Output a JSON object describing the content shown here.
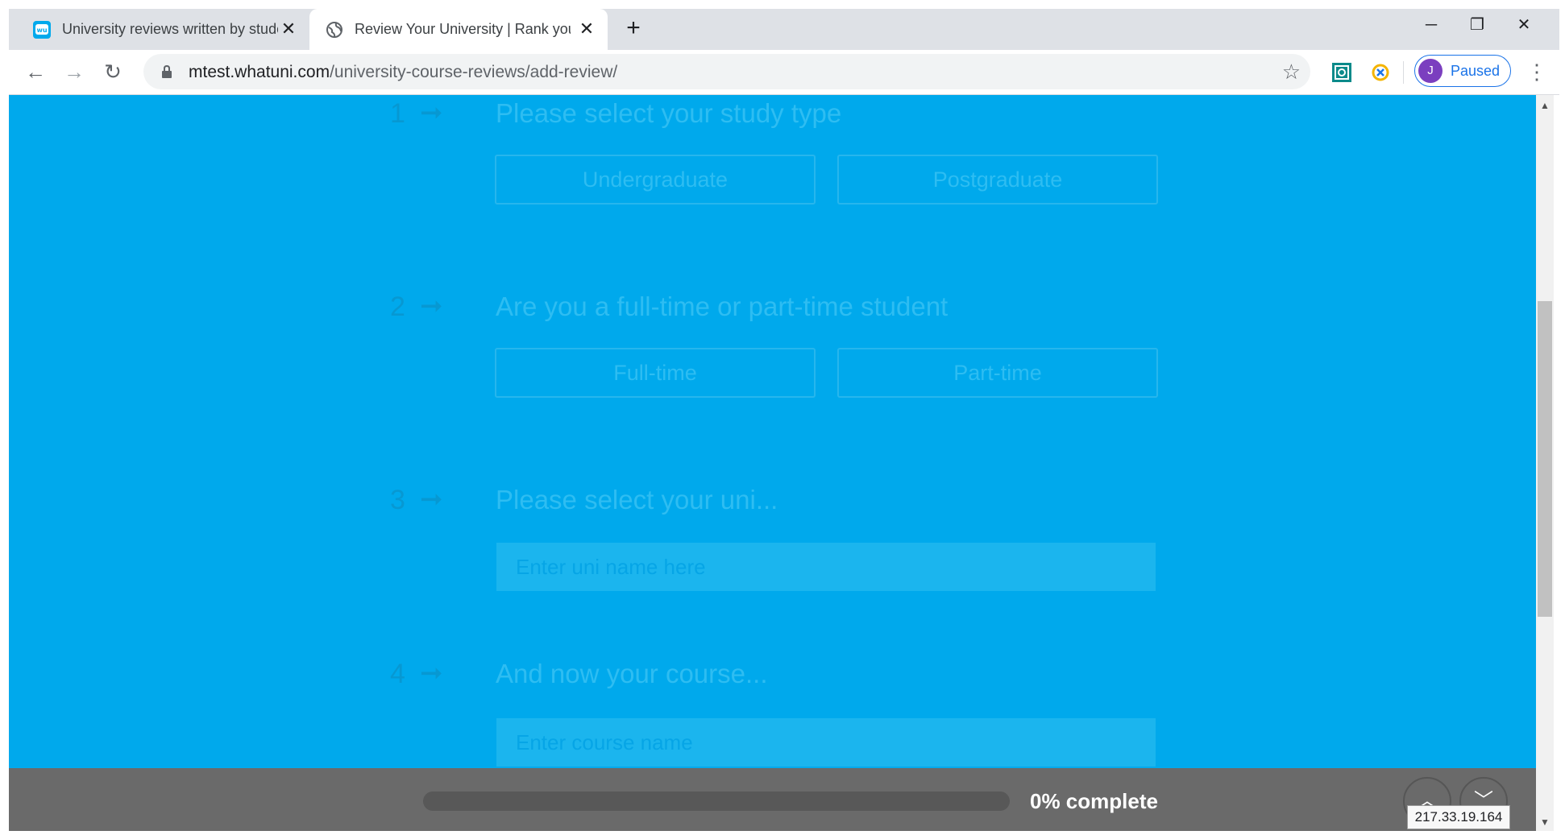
{
  "browser": {
    "tabs": [
      {
        "title": "University reviews written by students",
        "active": false,
        "favicon": "wu-logo-icon"
      },
      {
        "title": "Review Your University | Rank your uni",
        "active": true,
        "favicon": "globe-icon"
      }
    ],
    "new_tab_label": "+",
    "window_controls": {
      "minimize": "─",
      "restore": "❐",
      "close": "✕"
    },
    "nav": {
      "back": "←",
      "forward": "→",
      "reload": "↻"
    },
    "address_domain": "mtest.whatuni.com",
    "address_path": "/university-course-reviews/add-review/",
    "bookmark_star": "☆",
    "profile": {
      "initial": "J",
      "label": "Paused",
      "accent": "#1a73e8",
      "avatar_color": "#7b3fbf"
    },
    "menu": "⋮"
  },
  "form": {
    "background": "#00a9ec",
    "arrow": "➞",
    "questions": [
      {
        "number": "1",
        "text": "Please select your study type",
        "options": [
          "Undergraduate",
          "Postgraduate"
        ]
      },
      {
        "number": "2",
        "text": "Are you a full-time or part-time student",
        "options": [
          "Full-time",
          "Part-time"
        ]
      },
      {
        "number": "3",
        "text": "Please select your uni...",
        "placeholder": "Enter uni name here"
      },
      {
        "number": "4",
        "text": "And now your course...",
        "placeholder": "Enter course name"
      }
    ]
  },
  "progress": {
    "fraction": 0,
    "label": "0% complete",
    "up": "︿",
    "down": "﹀"
  },
  "ip_tooltip": "217.33.19.164"
}
